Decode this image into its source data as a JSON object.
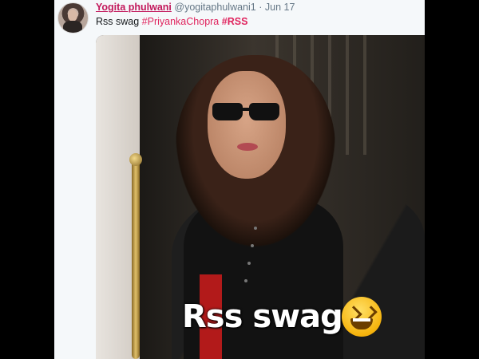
{
  "tweet": {
    "author_name": "Yogita phulwani",
    "author_handle": "@yogitaphulwani1",
    "separator": "·",
    "date": "Jun 17",
    "text_prefix": "Rss swag",
    "hashtags": [
      "#PriyankaChopra",
      "#RSS"
    ]
  },
  "media": {
    "overlay_caption": "Rss swag",
    "emoji": "grinning-squinting-face"
  },
  "colors": {
    "name_link": "#c2185b",
    "hashtag": "#e0245e",
    "meta_text": "#657786",
    "card_bg": "#f5f8fa",
    "page_bg": "#000000"
  }
}
